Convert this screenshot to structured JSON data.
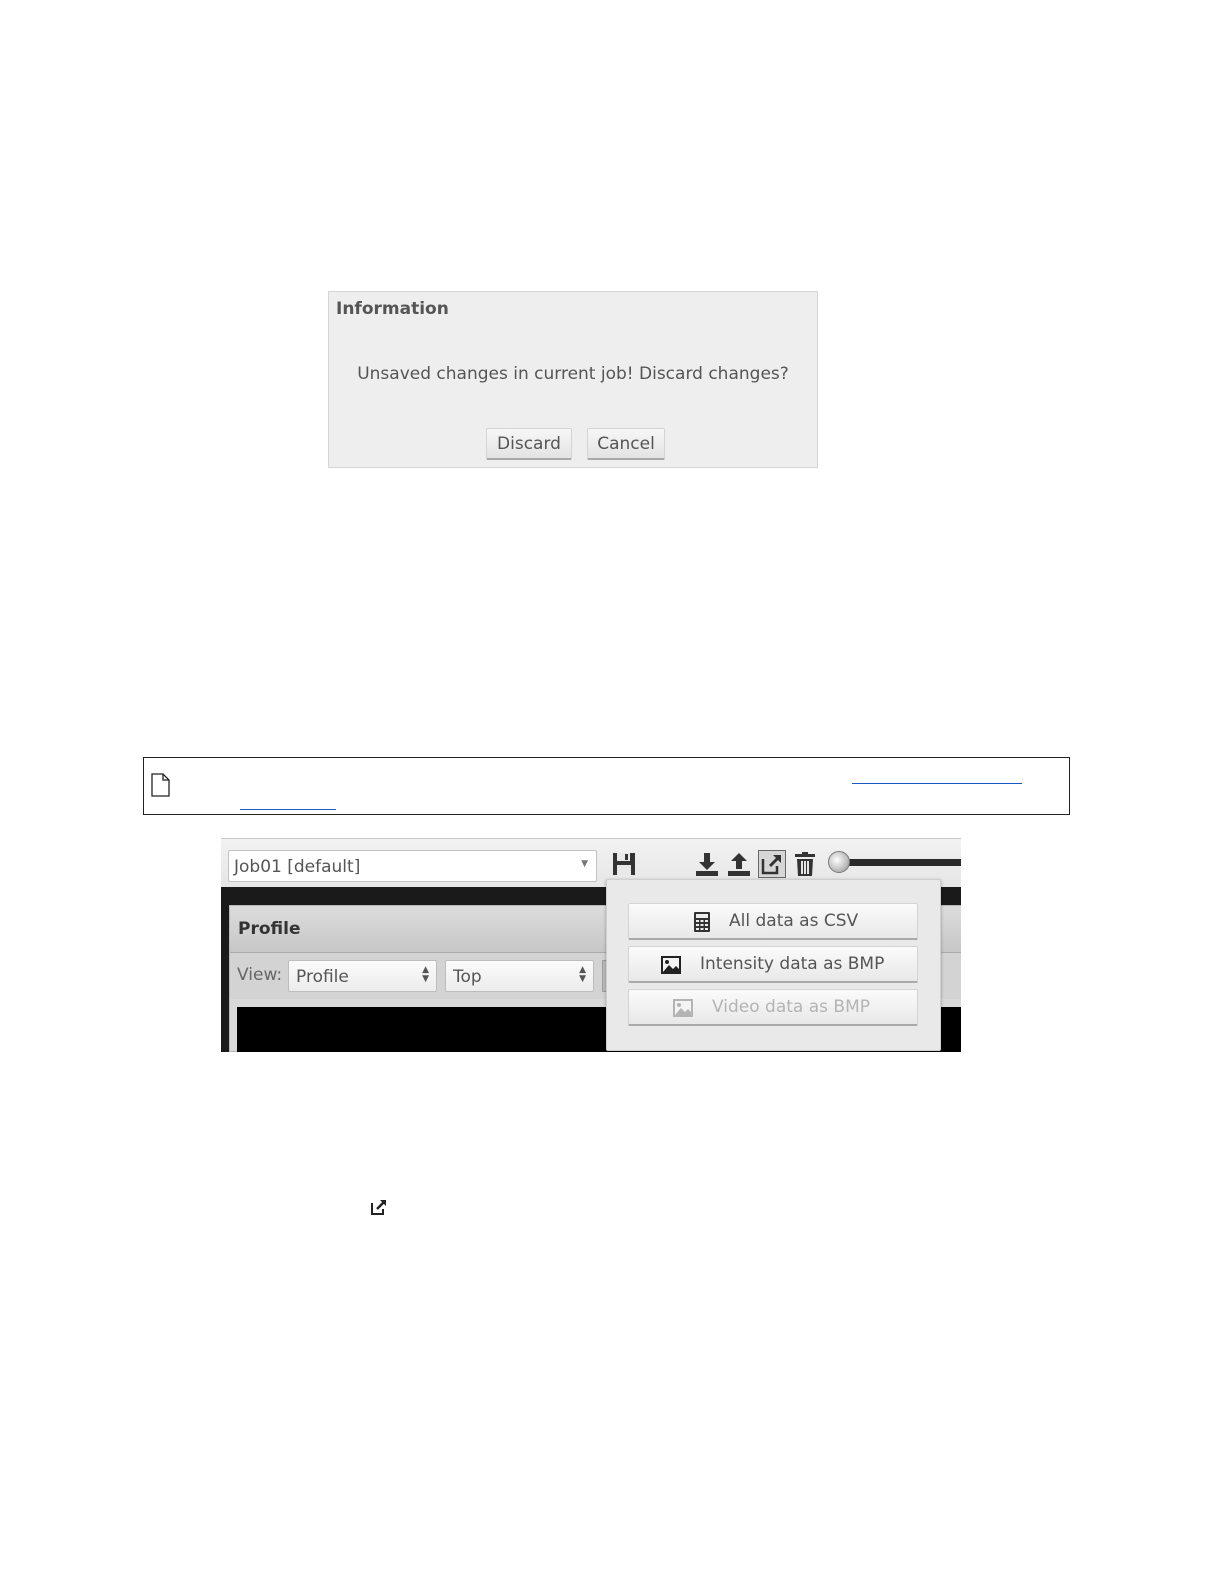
{
  "dialog": {
    "title": "Information",
    "message": "Unsaved changes in current job! Discard changes?",
    "discard_label": "Discard",
    "cancel_label": "Cancel"
  },
  "app": {
    "job_select_value": "Job01 [default]",
    "panel_title": "Profile",
    "view_label": "View:",
    "view_select_value": "Profile",
    "orientation_select_value": "Top",
    "export_menu": {
      "items": [
        {
          "label": "All data as CSV",
          "icon": "calculator-icon",
          "enabled": true
        },
        {
          "label": "Intensity data as BMP",
          "icon": "image-icon",
          "enabled": true
        },
        {
          "label": "Video data as BMP",
          "icon": "image-icon",
          "enabled": false
        }
      ]
    }
  },
  "icons": {
    "note": "document-icon",
    "toolbar": [
      "save-icon",
      "download-icon",
      "upload-icon",
      "export-icon",
      "trash-icon"
    ],
    "inline": "external-link-icon"
  },
  "colors": {
    "dialog_bg": "#eeeeee",
    "link": "#1a57c2",
    "disabled_text": "#b4b4b4"
  }
}
